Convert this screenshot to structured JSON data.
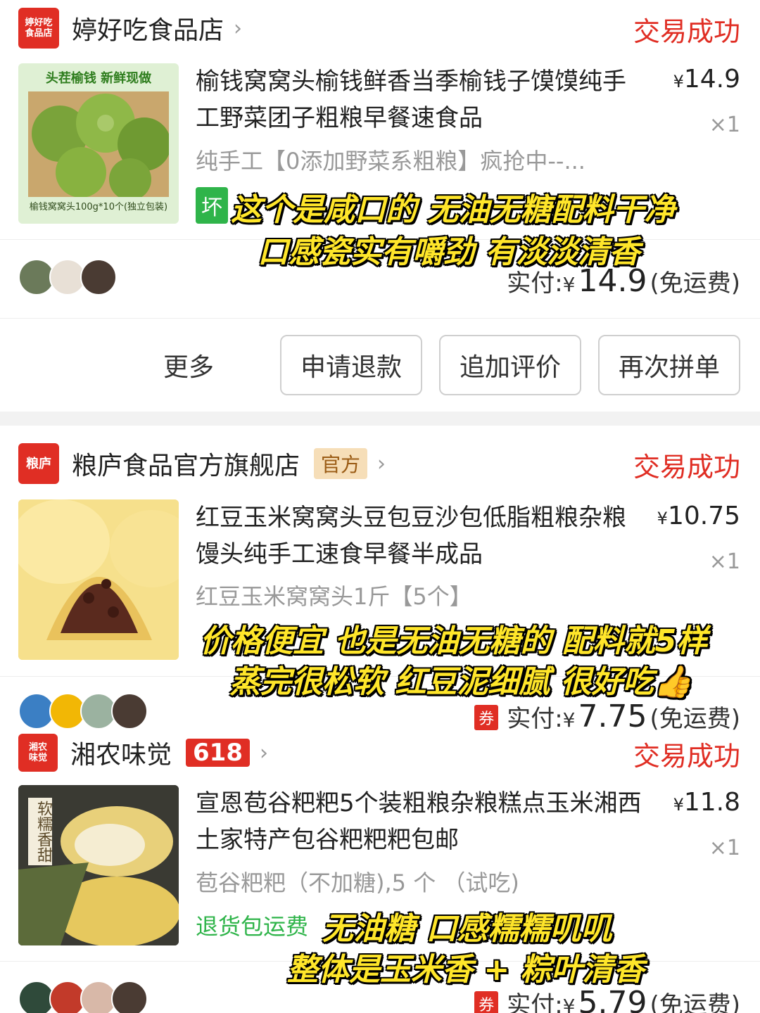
{
  "orders": [
    {
      "shop": {
        "logo_line1": "婷好吃",
        "logo_line2": "食品店",
        "name": "婷好吃食品店",
        "chevron": "›"
      },
      "status": "交易成功",
      "product": {
        "title": "榆钱窝窝头榆钱鲜香当季榆钱子馍馍纯手工野菜团子粗粮早餐速食品",
        "spec": "纯手工【0添加野菜系粗粮】疯抢中--...",
        "price_symbol": "¥",
        "price": "14.9",
        "qty": "×1",
        "tag": "坏",
        "thumb_banner": "头茬榆钱 新鲜现做",
        "thumb_caption": "榆钱窝窝头100g*10个(独立包装)"
      },
      "paid": {
        "label": "实付:",
        "symbol": "¥",
        "amount": "14.9",
        "note": "(免运费)"
      },
      "caption": [
        "这个是咸口的 无油无糖配料干净",
        "口感瓷实有嚼劲 有淡淡清香"
      ],
      "actions": {
        "more": "更多",
        "refund": "申请退款",
        "review": "追加评价",
        "reorder": "再次拼单"
      }
    },
    {
      "shop": {
        "logo": "粮庐",
        "name": "粮庐食品官方旗舰店",
        "tag": "官方",
        "chevron": "›"
      },
      "status": "交易成功",
      "product": {
        "title": "红豆玉米窝窝头豆包豆沙包低脂粗粮杂粮馒头纯手工速食早餐半成品",
        "spec": "红豆玉米窝窝头1斤【5个】",
        "price_symbol": "¥",
        "price": "10.75",
        "qty": "×1"
      },
      "paid": {
        "coupon": "券",
        "label": "实付:",
        "symbol": "¥",
        "amount": "7.75",
        "note": "(免运费)"
      },
      "caption": [
        "价格便宜 也是无油无糖的 配料就5样",
        "蒸完很松软 红豆泥细腻 很好吃👍"
      ]
    },
    {
      "shop": {
        "logo_line1": "湘农",
        "logo_line2": "味觉",
        "name": "湘农味觉",
        "tag": "618",
        "chevron": "›"
      },
      "status": "交易成功",
      "product": {
        "title": "宣恩苞谷粑粑5个装粗粮杂粮糕点玉米湘西土家特产包谷粑粑粑包邮",
        "spec": "苞谷粑粑（不加糖),5 个 （试吃)",
        "price_symbol": "¥",
        "price": "11.8",
        "qty": "×1",
        "green_text": "退货包运费",
        "thumb_text": "软糯香甜"
      },
      "paid": {
        "coupon": "券",
        "label": "实付:",
        "symbol": "¥",
        "amount": "5.79",
        "note": "(免运费)"
      },
      "caption": [
        "无油糖 口感糯糯叽叽",
        "整体是玉米香 + 粽叶清香"
      ]
    }
  ],
  "colors": {
    "accent": "#e02e24",
    "green": "#2fb44a",
    "caption": "#ffe62a"
  }
}
